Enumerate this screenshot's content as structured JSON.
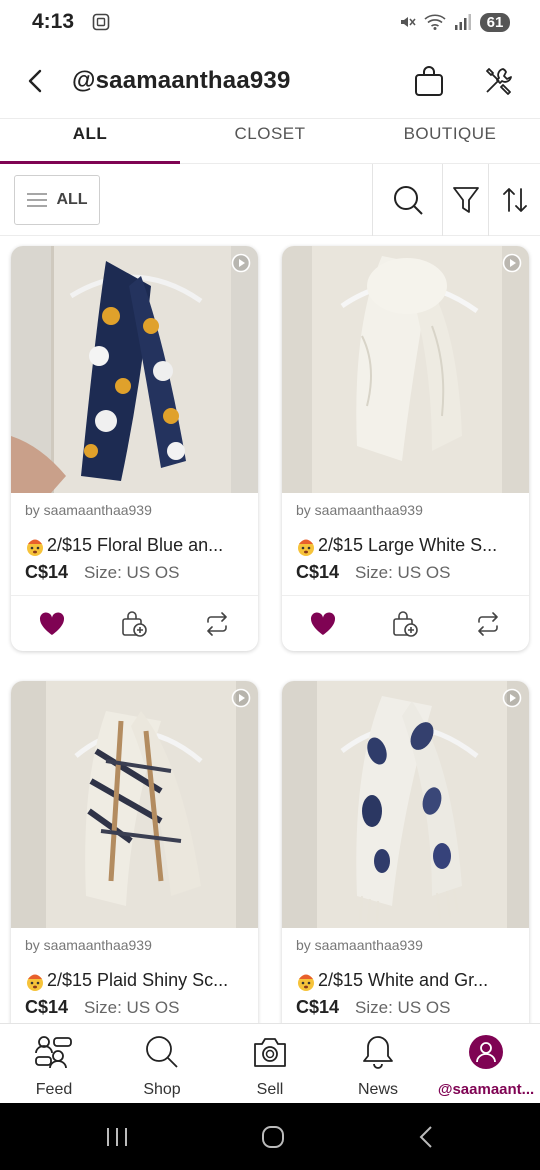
{
  "status": {
    "time": "4:13",
    "battery": "61"
  },
  "header": {
    "title": "@saamaanthaa939"
  },
  "tabs": [
    {
      "label": "ALL",
      "active": true
    },
    {
      "label": "CLOSET",
      "active": false
    },
    {
      "label": "BOUTIQUE",
      "active": false
    }
  ],
  "filter": {
    "label": "ALL"
  },
  "listings": [
    {
      "seller": "by saamaanthaa939",
      "title": "2/$15 Floral Blue an...",
      "price": "C$14",
      "size": "Size: US OS",
      "liked": true,
      "image": "floral-scarf"
    },
    {
      "seller": "by saamaanthaa939",
      "title": "2/$15 Large White S...",
      "price": "C$14",
      "size": "Size: US OS",
      "liked": true,
      "image": "white-scarf"
    },
    {
      "seller": "by saamaanthaa939",
      "title": "2/$15 Plaid Shiny Sc...",
      "price": "C$14",
      "size": "Size: US OS",
      "liked": false,
      "image": "plaid-scarf"
    },
    {
      "seller": "by saamaanthaa939",
      "title": "2/$15 White and Gr...",
      "price": "C$14",
      "size": "Size: US OS",
      "liked": false,
      "image": "white-grey-scarf"
    }
  ],
  "nav": [
    {
      "label": "Feed",
      "icon": "feed-icon"
    },
    {
      "label": "Shop",
      "icon": "search-icon"
    },
    {
      "label": "Sell",
      "icon": "camera-icon"
    },
    {
      "label": "News",
      "icon": "bell-icon"
    },
    {
      "label": "@saamaant...",
      "icon": "avatar-icon",
      "active": true
    }
  ],
  "colors": {
    "accent": "#7f0353",
    "border": "#ececec",
    "text": "#222222"
  }
}
